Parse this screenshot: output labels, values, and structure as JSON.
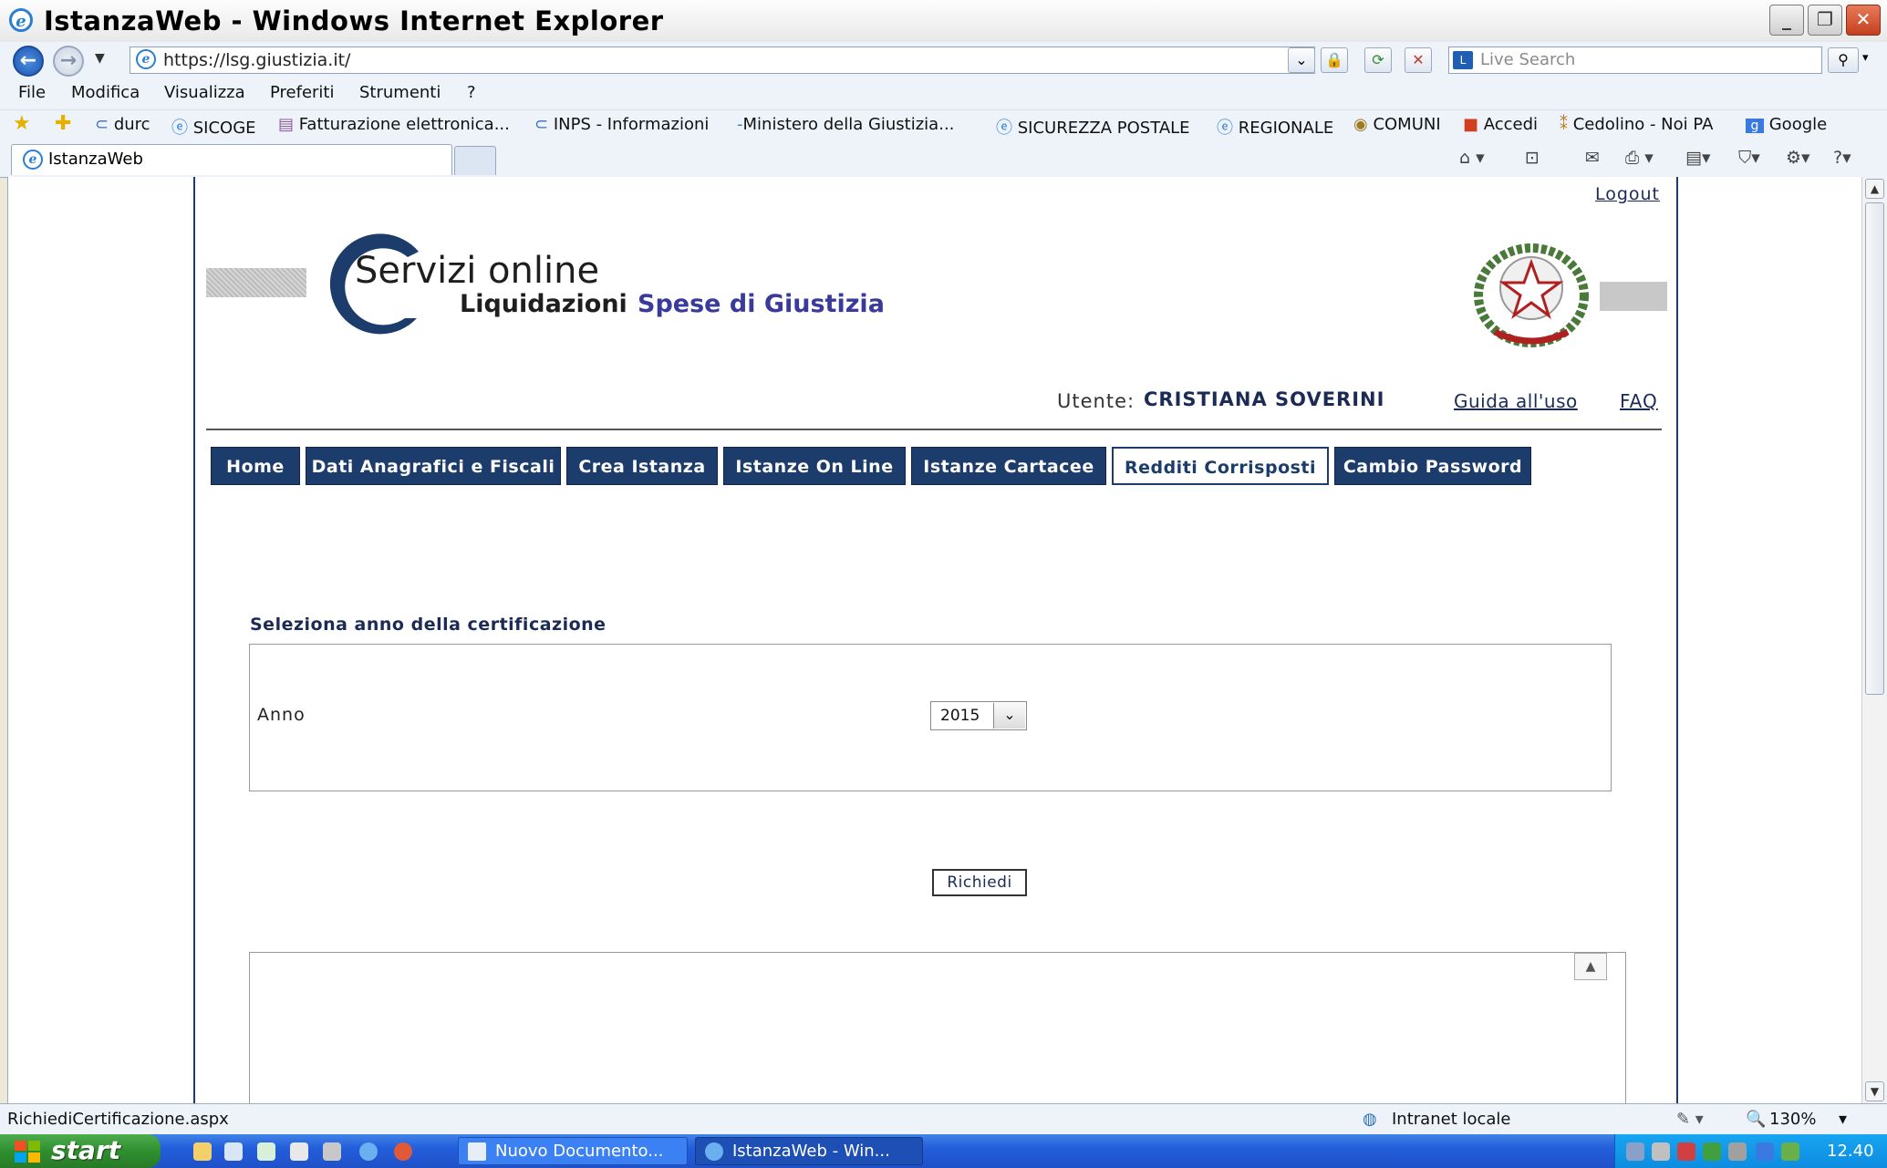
{
  "window": {
    "title": "IstanzaWeb - Windows Internet Explorer"
  },
  "browser": {
    "address": "https://lsg.giustizia.it/",
    "search_placeholder": "Live Search",
    "menu": [
      "File",
      "Modifica",
      "Visualizza",
      "Preferiti",
      "Strumenti",
      "?"
    ],
    "favorites": [
      "durc",
      "SICOGE",
      "Fatturazione elettronica...",
      "INPS - Informazioni",
      "Ministero della Giustizia...",
      "SICUREZZA POSTALE",
      "REGIONALE",
      "COMUNI",
      "Accedi",
      "Cedolino - Noi PA",
      "Google"
    ],
    "tab_title": "IstanzaWeb"
  },
  "page": {
    "logout": "Logout",
    "logo": {
      "servizi": "Servizi online",
      "liquidazioni": "Liquidazioni",
      "spese": "Spese di Giustizia"
    },
    "user_label": "Utente:",
    "user_name": "CRISTIANA SOVERINI",
    "guida": "Guida all'uso",
    "faq": "FAQ",
    "nav": [
      {
        "label": "Home",
        "active": false
      },
      {
        "label": "Dati Anagrafici e Fiscali",
        "active": false
      },
      {
        "label": "Crea Istanza",
        "active": false
      },
      {
        "label": "Istanze On Line",
        "active": false
      },
      {
        "label": "Istanze Cartacee",
        "active": false
      },
      {
        "label": "Redditi Corrisposti",
        "active": true
      },
      {
        "label": "Cambio Password",
        "active": false
      }
    ],
    "section_title": "Seleziona anno della certificazione",
    "anno_label": "Anno",
    "anno_value": "2015",
    "request_button": "Richiedi"
  },
  "status": {
    "url": "RichiediCertificazione.aspx",
    "zone": "Intranet locale",
    "zoom": "130%"
  },
  "taskbar": {
    "start": "start",
    "tasks": [
      "Nuovo Documento...",
      "IstanzaWeb - Win..."
    ],
    "clock": "12.40"
  },
  "colors": {
    "nav_bg": "#1c3d6b",
    "accent_text": "#1b2b55",
    "spese_text": "#3a3a9a"
  }
}
